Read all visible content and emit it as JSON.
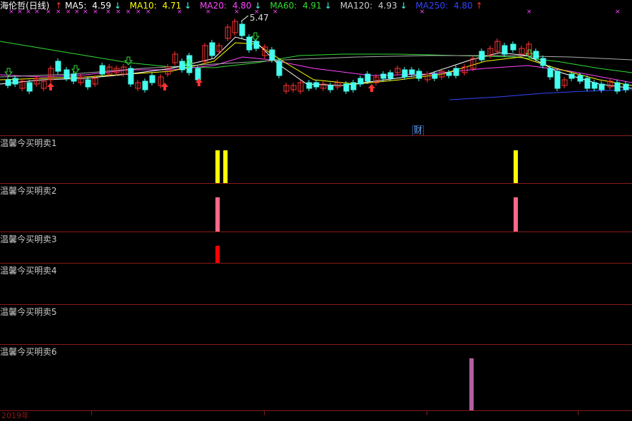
{
  "header": {
    "stock": "海伦哲(日线)",
    "ma": [
      {
        "label": "MA5: ",
        "value": "4.59",
        "arrow": "↓",
        "color": "#ffffff",
        "arrow_color": "#ff3b3b",
        "prefix_arrow": "↑"
      },
      {
        "label": "MA10: ",
        "value": "4.71",
        "arrow": "↓",
        "color": "#ffff00"
      },
      {
        "label": "MA20: ",
        "value": "4.80",
        "arrow": "↓",
        "color": "#ff44ff"
      },
      {
        "label": "MA60: ",
        "value": "4.91",
        "arrow": "↓",
        "color": "#33dd33"
      },
      {
        "label": "MA120: ",
        "value": "4.93",
        "arrow": "↓",
        "color": "#cccccc"
      },
      {
        "label": "MA250: ",
        "value": "4.80",
        "arrow": "↑",
        "color": "#3344ff"
      }
    ]
  },
  "price_annotation": "5.47",
  "finance_marker": "财",
  "panes": [
    {
      "label": "温馨今买明卖1"
    },
    {
      "label": "温馨今买明卖2"
    },
    {
      "label": "温馨今买明卖3"
    },
    {
      "label": "温馨今买明卖4"
    },
    {
      "label": "温馨今买明卖5"
    },
    {
      "label": "温馨今买明卖6"
    }
  ],
  "indicator_bars": [
    {
      "pane": 1,
      "color": "#ffff00",
      "count": 3
    },
    {
      "pane": 2,
      "color": "#ff6688",
      "count": 2
    },
    {
      "pane": 3,
      "color": "#ff0000",
      "count": 1
    },
    {
      "pane": 6,
      "color": "#b060a0",
      "count": 1
    }
  ],
  "colors": {
    "up": "#ff3333",
    "down": "#44ffee",
    "grid": "#8a1a1a"
  },
  "footer": {
    "year": "2019年"
  }
}
